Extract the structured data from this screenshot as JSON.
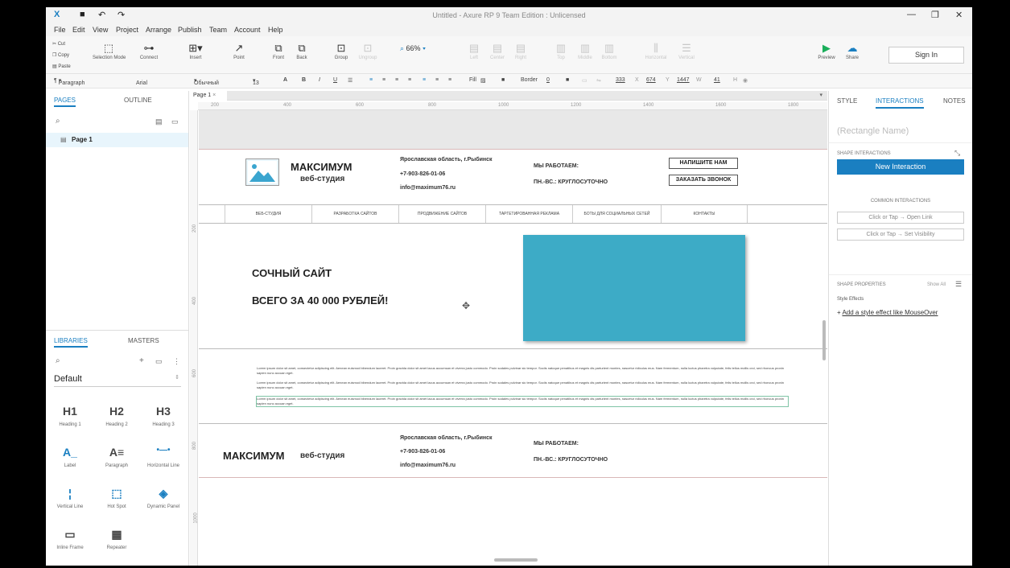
{
  "window": {
    "title": "Untitled - Axure RP 9 Team Edition : Unlicensed"
  },
  "menu": [
    "File",
    "Edit",
    "View",
    "Project",
    "Arrange",
    "Publish",
    "Team",
    "Account",
    "Help"
  ],
  "toolbar": {
    "edit": [
      "Cut",
      "Copy",
      "Paste"
    ],
    "tools": [
      "Selection Mode",
      "Connect",
      "Insert",
      "Point",
      "Front",
      "Back",
      "Group",
      "Ungroup"
    ],
    "zoom": "66%",
    "align": [
      "Left",
      "Center",
      "Right",
      "Top",
      "Middle",
      "Bottom",
      "Horizontal",
      "Vertical"
    ],
    "preview": "Preview",
    "share": "Share",
    "signin": "Sign In"
  },
  "format": {
    "style": "Paragraph",
    "font": "Arial",
    "weight": "Обычный",
    "size": "13",
    "fill": "Fill",
    "border": "Border",
    "border_val": "0",
    "x": "333",
    "x_lbl": "X",
    "y": "674",
    "y_lbl": "Y",
    "w": "1447",
    "w_lbl": "W",
    "h": "41",
    "h_lbl": "H"
  },
  "left": {
    "tabs": [
      "PAGES",
      "OUTLINE"
    ],
    "page": "Page 1",
    "lib_tabs": [
      "LIBRARIES",
      "MASTERS"
    ],
    "library": "Default",
    "widgets": [
      {
        "icon": "H1",
        "label": "Heading 1"
      },
      {
        "icon": "H2",
        "label": "Heading 2"
      },
      {
        "icon": "H3",
        "label": "Heading 3"
      },
      {
        "icon": "A_",
        "label": "Label"
      },
      {
        "icon": "A≡",
        "label": "Paragraph"
      },
      {
        "icon": "•—•",
        "label": "Horizontal Line"
      },
      {
        "icon": "¦",
        "label": "Vertical Line"
      },
      {
        "icon": "⬚",
        "label": "Hot Spot"
      },
      {
        "icon": "◈",
        "label": "Dynamic Panel"
      },
      {
        "icon": "▭",
        "label": "Inline Frame"
      },
      {
        "icon": "▦",
        "label": "Repeater"
      }
    ]
  },
  "canvas": {
    "tab": "Page 1",
    "ruler_h": [
      "200",
      "400",
      "600",
      "800",
      "1000",
      "1200",
      "1400",
      "1600",
      "1800"
    ],
    "ruler_v": [
      "200",
      "400",
      "600",
      "800",
      "1000"
    ],
    "header": {
      "brand": "МАКСИМУМ",
      "brand_sub": "веб-студия",
      "address": "Ярославская область, г.Рыбинск",
      "phone": "+7-903-826-01-06",
      "email": "info@maximum76.ru",
      "hours_title": "МЫ РАБОТАЕМ:",
      "hours": "ПН.-ВС.: КРУГЛОСУТОЧНО",
      "btn_write": "НАПИШИТЕ НАМ",
      "btn_call": "ЗАКАЗАТЬ ЗВОНОК"
    },
    "nav": [
      "ВЕБ-СТУДИЯ",
      "РАЗРАБОТКА САЙТОВ",
      "ПРОДВИЖЕНИЕ САЙТОВ",
      "ТАРГЕТИРОВАННАЯ РЕКЛАМА",
      "БОТЫ ДЛЯ СОЦИАЛЬНЫХ СЕТЕЙ",
      "КОНТАКТЫ"
    ],
    "hero_line1": "СОЧНЫЙ САЙТ",
    "hero_line2": "ВСЕГО ЗА 40 000 РУБЛЕЙ!",
    "lorem": "Lorem ipsum dolor sit amet, consectetur adipiscing elit. Aenean euismod bibendum laoreet. Proin gravida dolor sit amet lacus accumsan et viverra justo commodo. Proin sodales pulvinar sic tempor. Sociis natoque penatibus et magnis dis parturient montes, nascetur ridiculus mus. Nam fermentum, nulla luctus pharetra vulputate, felis tellus mollis orci, sed rhoncus pronin sapien nunc accuan eget.",
    "footer": {
      "brand": "МАКСИМУМ",
      "brand_sub": "веб-студия",
      "address": "Ярославская область, г.Рыбинск",
      "phone": "+7-903-826-01-06",
      "email": "info@maximum76.ru",
      "hours_title": "МЫ РАБОТАЕМ:",
      "hours": "ПН.-ВС.: КРУГЛОСУТОЧНО"
    }
  },
  "right": {
    "tabs": [
      "STYLE",
      "INTERACTIONS",
      "NOTES"
    ],
    "name_placeholder": "(Rectangle Name)",
    "shape_interactions": "SHAPE INTERACTIONS",
    "new_interaction": "New Interaction",
    "common": "COMMON INTERACTIONS",
    "common_items": [
      "Click or Tap → Open Link",
      "Click or Tap → Set Visibility"
    ],
    "shape_props": "SHAPE PROPERTIES",
    "show_all": "Show All",
    "style_effects": "Style Effects",
    "add_effect": "Add a style effect like MouseOver"
  },
  "colors": {
    "accent": "#1a7fc1",
    "hero": "#3dabc6",
    "preview": "#1aae5a"
  }
}
